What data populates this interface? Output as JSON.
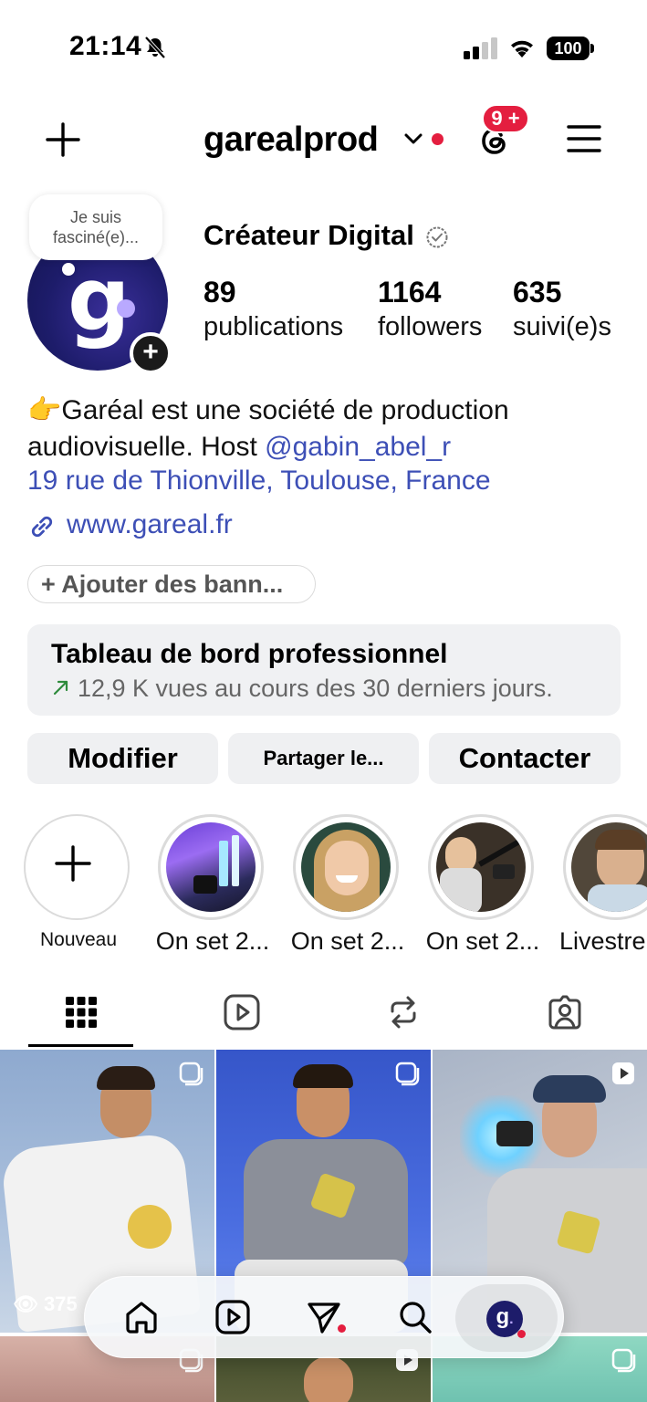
{
  "status_bar": {
    "time": "21:14",
    "battery": "100"
  },
  "header": {
    "username": "garealprod",
    "notifications_badge": "9 +"
  },
  "profile": {
    "note": "Je suis fasciné(e)...",
    "category": "Créateur Digital",
    "stats": [
      {
        "value": "89",
        "label": "publications"
      },
      {
        "value": "1164",
        "label": "followers"
      },
      {
        "value": "635",
        "label": "suivi(e)s"
      }
    ],
    "bio_emoji": "👉",
    "bio_text": "Garéal est une société de production audiovisuelle. Host ",
    "bio_mention": "@gabin_abel_r",
    "address": "19 rue de Thionville, Toulouse, France",
    "link": "www.gareal.fr",
    "banner_button": "+ Ajouter des bann..."
  },
  "dashboard": {
    "title": "Tableau de bord professionnel",
    "subtitle": "12,9 K vues au cours des 30 derniers jours."
  },
  "actions": {
    "edit": "Modifier",
    "share": "Partager le...",
    "contact": "Contacter"
  },
  "highlights": [
    {
      "label": "Nouveau"
    },
    {
      "label": "On set 2..."
    },
    {
      "label": "On set 2..."
    },
    {
      "label": "On set 2..."
    },
    {
      "label": "Livestre"
    }
  ],
  "grid": {
    "first_tile_views": "375"
  },
  "colors": {
    "link": "#3d4fb6",
    "badge_red": "#e41e3f",
    "avatar_navy": "#1d1c6a"
  }
}
